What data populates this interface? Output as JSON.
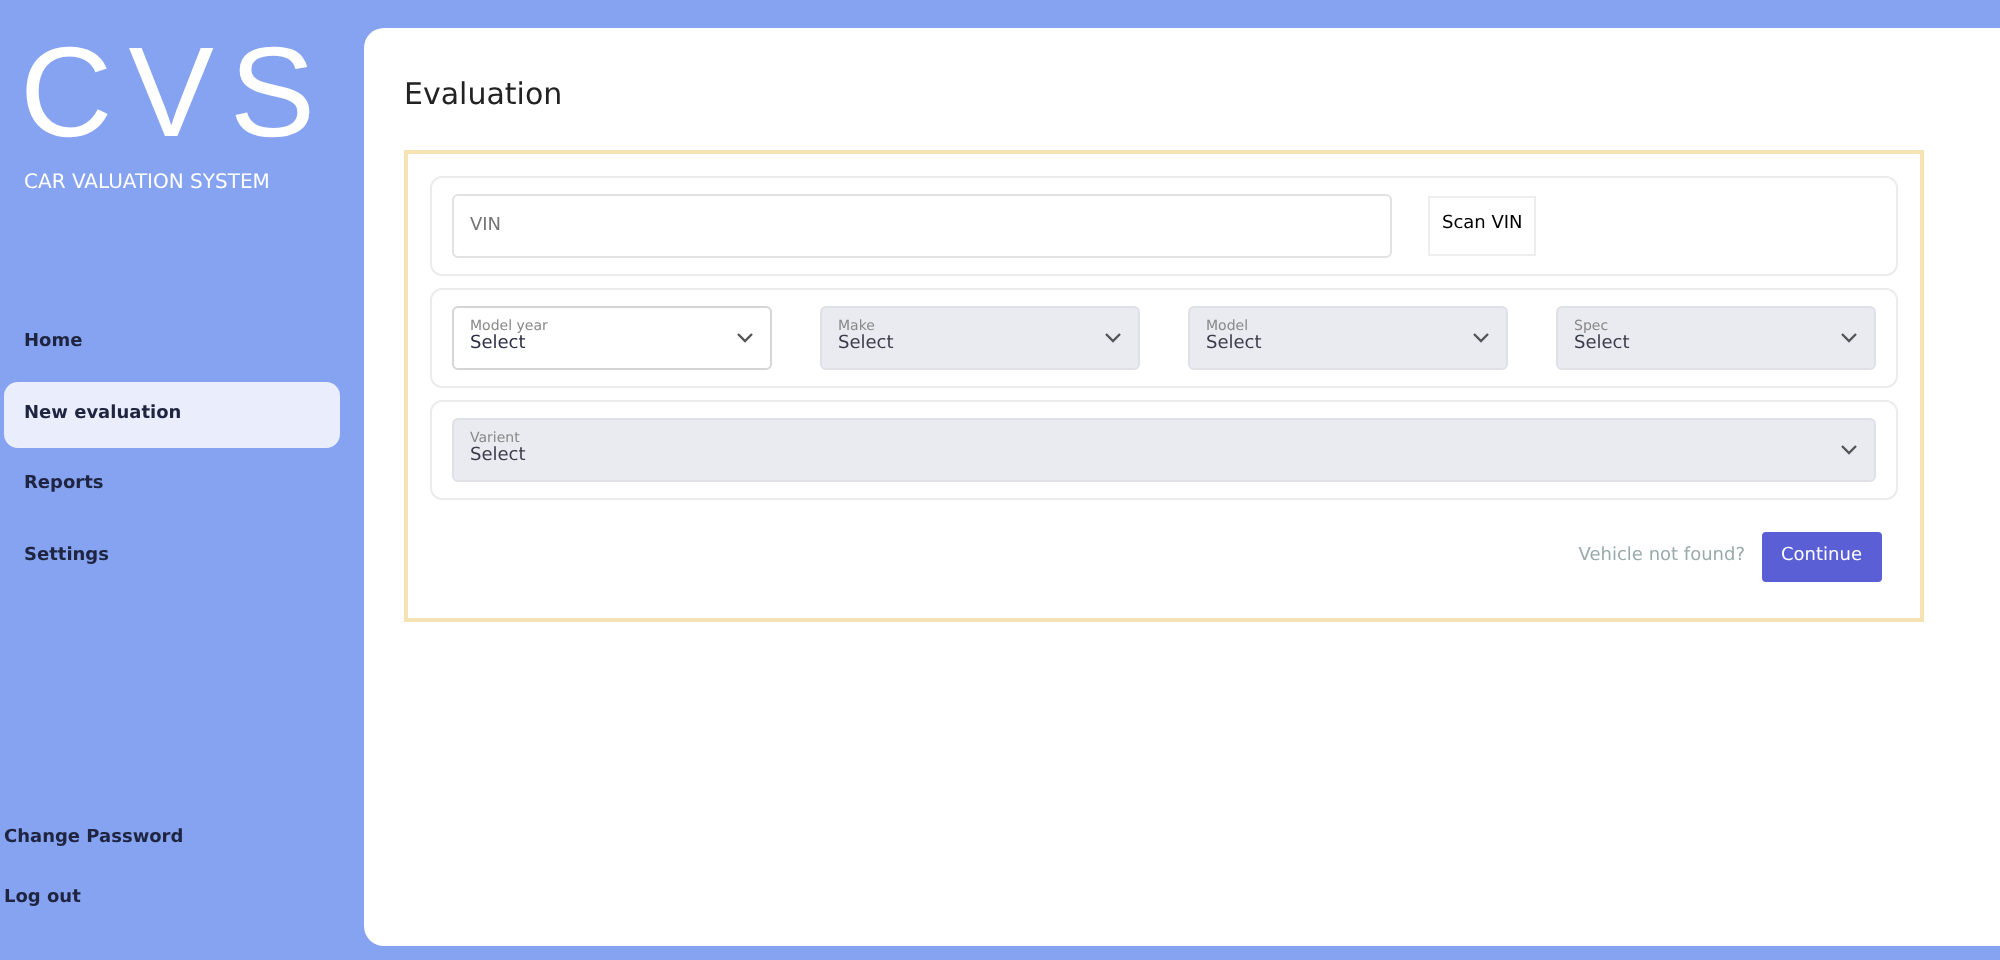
{
  "sidebar": {
    "logo": "CVS",
    "tagline": "CAR VALUATION SYSTEM",
    "items": [
      {
        "label": "Home",
        "selected": false
      },
      {
        "label": "New evaluation",
        "selected": true
      },
      {
        "label": "Reports",
        "selected": false
      },
      {
        "label": "Settings",
        "selected": false
      }
    ],
    "footer_items": [
      "Change Password",
      "Log out"
    ]
  },
  "page": {
    "title": "Evaluation"
  },
  "vin": {
    "placeholder": "VIN",
    "button": "Scan VIN"
  },
  "selects": [
    {
      "label": "Model year",
      "value": "Select",
      "disabled": false
    },
    {
      "label": "Make",
      "value": "Select",
      "disabled": true
    },
    {
      "label": "Model",
      "value": "Select",
      "disabled": true
    },
    {
      "label": "Spec",
      "value": "Select",
      "disabled": true
    }
  ],
  "variant": {
    "label": "Varient",
    "value": "Select",
    "disabled": true
  },
  "footer": {
    "link": "Vehicle not found?",
    "button": "Continue"
  }
}
